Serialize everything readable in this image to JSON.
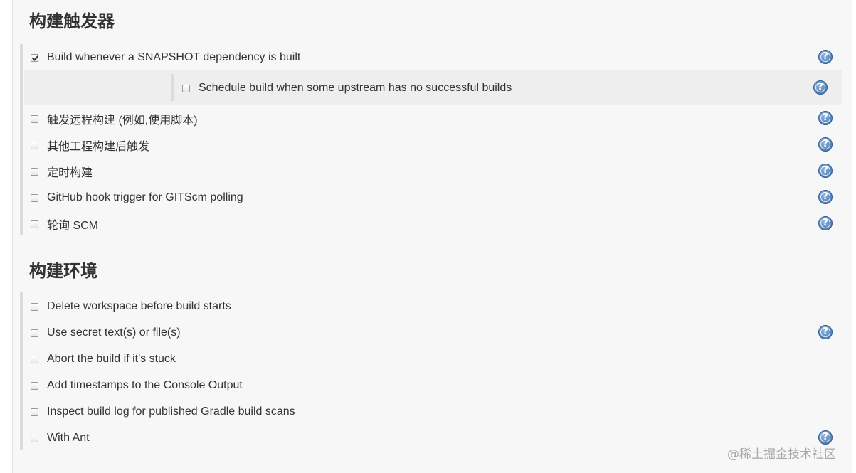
{
  "build_triggers": {
    "title": "构建触发器",
    "items": [
      {
        "label": "Build whenever a SNAPSHOT dependency is built",
        "checked": true,
        "help": true
      },
      {
        "label": "Schedule build when some upstream has no successful builds",
        "checked": false,
        "help": true
      },
      {
        "label": "触发远程构建 (例如,使用脚本)",
        "checked": false,
        "help": true
      },
      {
        "label": "其他工程构建后触发",
        "checked": false,
        "help": true
      },
      {
        "label": "定时构建",
        "checked": false,
        "help": true
      },
      {
        "label": "GitHub hook trigger for GITScm polling",
        "checked": false,
        "help": true
      },
      {
        "label": "轮询 SCM",
        "checked": false,
        "help": true
      }
    ]
  },
  "build_environment": {
    "title": "构建环境",
    "items": [
      {
        "label": "Delete workspace before build starts",
        "checked": false,
        "help": false
      },
      {
        "label": "Use secret text(s) or file(s)",
        "checked": false,
        "help": true
      },
      {
        "label": "Abort the build if it's stuck",
        "checked": false,
        "help": false
      },
      {
        "label": "Add timestamps to the Console Output",
        "checked": false,
        "help": false
      },
      {
        "label": "Inspect build log for published Gradle build scans",
        "checked": false,
        "help": false
      },
      {
        "label": "With Ant",
        "checked": false,
        "help": true
      }
    ]
  },
  "help_icon_glyph": "?",
  "watermark": "@稀土掘金技术社区",
  "colors": {
    "help_icon": "#3f6fa8",
    "panel_bg": "#f7f7f7"
  }
}
